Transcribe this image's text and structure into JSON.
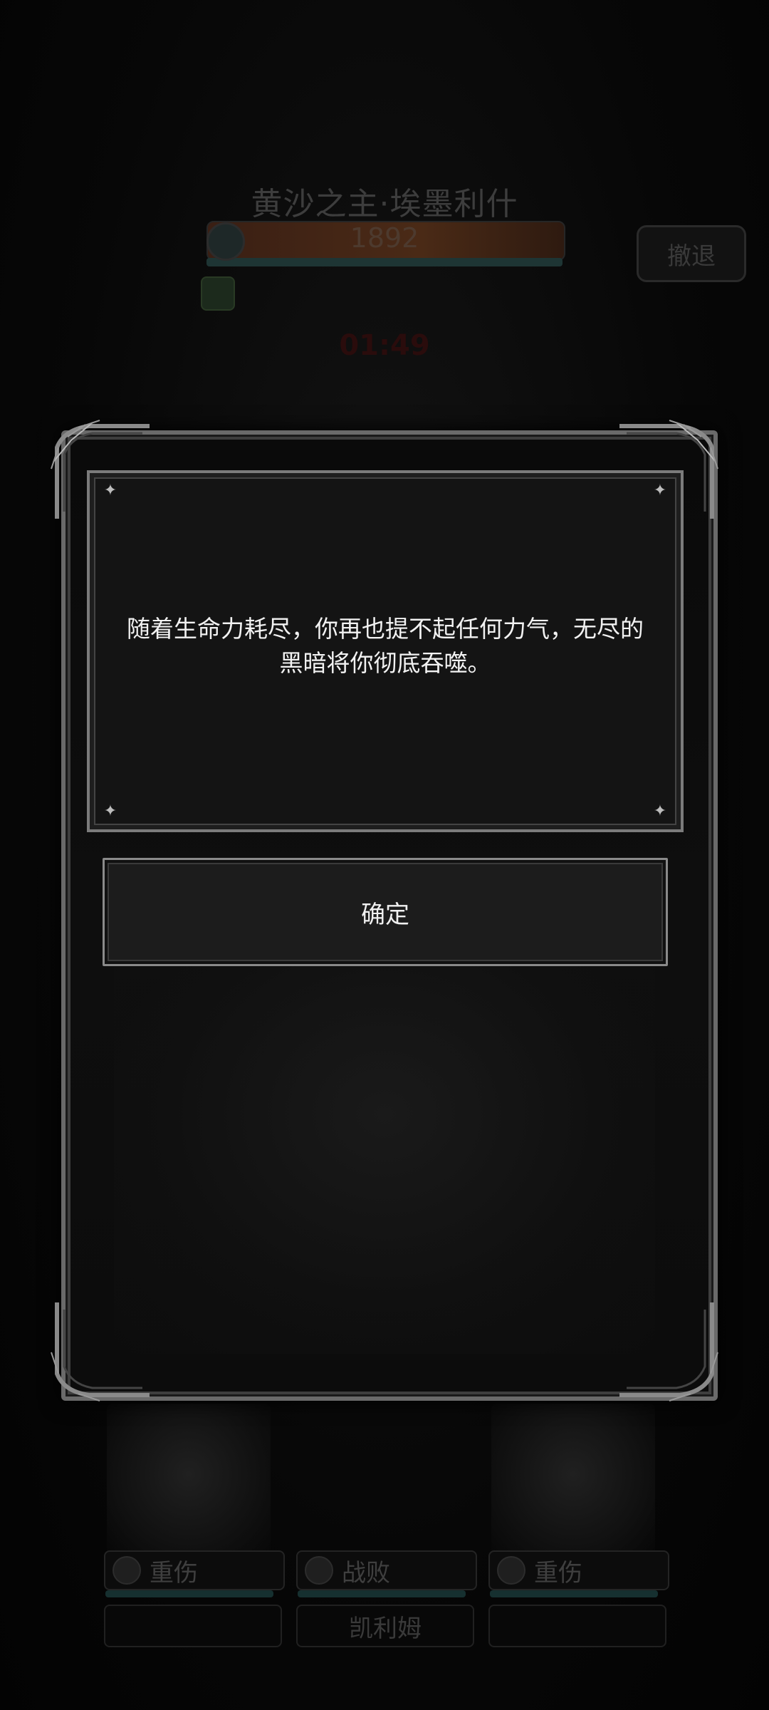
{
  "boss": {
    "name": "黄沙之主·埃墨利什",
    "hp": "1892",
    "turn_timer": "01:49"
  },
  "header": {
    "retreat_label": "撤退"
  },
  "dialog": {
    "message": "随着生命力耗尽，你再也提不起任何力气，无尽的黑暗将你彻底吞噬。",
    "confirm_label": "确定"
  },
  "party": {
    "slots": [
      {
        "status": "重伤",
        "name": ""
      },
      {
        "status": "战败",
        "name": "凯利姆"
      },
      {
        "status": "重伤",
        "name": ""
      }
    ]
  },
  "colors": {
    "frame": "#7b7b7b",
    "panel": "#141414",
    "text": "#f2f2f2"
  }
}
